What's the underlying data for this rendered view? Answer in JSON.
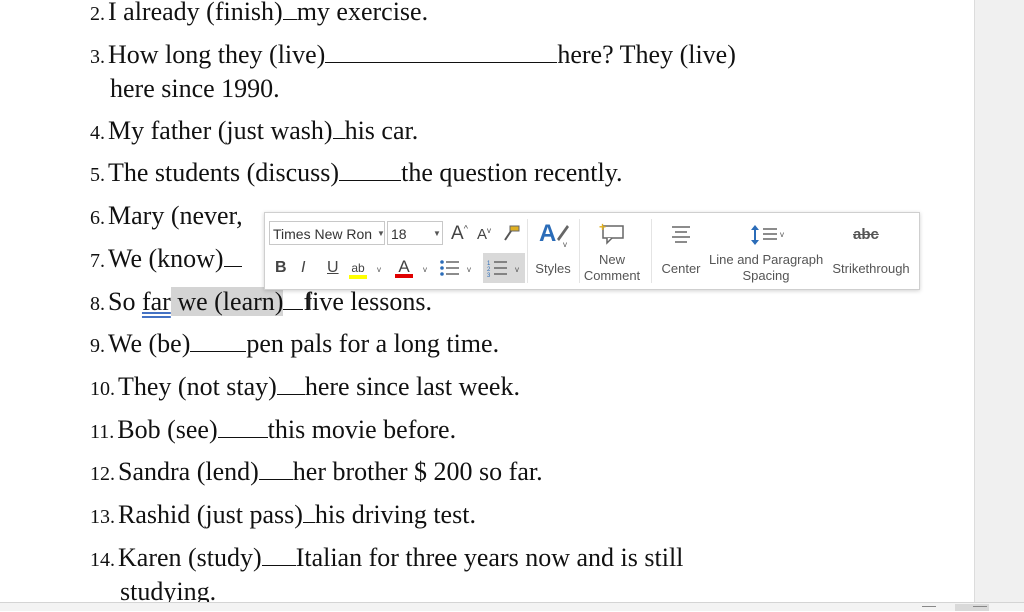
{
  "questions": [
    {
      "num": "2.",
      "before": "I already (finish)",
      "after": "my exercise."
    },
    {
      "num": "3.",
      "before": "How long they (live)",
      "after": "here? They (live)",
      "cont": "here since 1990."
    },
    {
      "num": "4.",
      "before": "My father (just wash)",
      "after": "his car."
    },
    {
      "num": "5.",
      "before": "The students (discuss)",
      "after": "the question recently."
    },
    {
      "num": "6.",
      "visible": "Mary (never,"
    },
    {
      "num": "7.",
      "visible": "We (know)"
    },
    {
      "num": "8.",
      "p1": "So ",
      "p2": "far",
      "p3": " we (learn)",
      "after": "five lessons."
    },
    {
      "num": "9.",
      "before": "We (be)",
      "after": "pen pals for a long time."
    },
    {
      "num": "10.",
      "before": "They (not stay)",
      "after": "here since last week."
    },
    {
      "num": "11.",
      "before": "Bob (see)",
      "after": "this movie before."
    },
    {
      "num": "12.",
      "before": "Sandra (lend)",
      "after": "her brother $ 200 so far."
    },
    {
      "num": "13.",
      "before": "Rashid (just pass)",
      "after": "his driving test."
    },
    {
      "num": "14.",
      "before": "Karen (study)",
      "after": "Italian for three years now and is still",
      "cont": "studying."
    }
  ],
  "mini_toolbar": {
    "font_name": "Times New Ron",
    "font_size": "18",
    "styles_label": "Styles",
    "new_comment_line1": "New",
    "new_comment_line2": "Comment",
    "center_label": "Center",
    "spacing_line1": "Line and Paragraph",
    "spacing_line2": "Spacing",
    "strikethrough_label": "Strikethrough",
    "strikethrough_glyph": "abc",
    "bold": "B",
    "italic": "I",
    "underline": "U",
    "font_color_glyph": "A",
    "grow_glyph": "A",
    "shrink_glyph": "A",
    "highlight_glyph": "ab"
  },
  "colors": {
    "font_color_bar": "#e00000",
    "highlight_bar": "#ffff00",
    "styles_icon": "#2b6cb8",
    "comment_icon": "#e0b020",
    "selection": "#d4d4d4"
  }
}
